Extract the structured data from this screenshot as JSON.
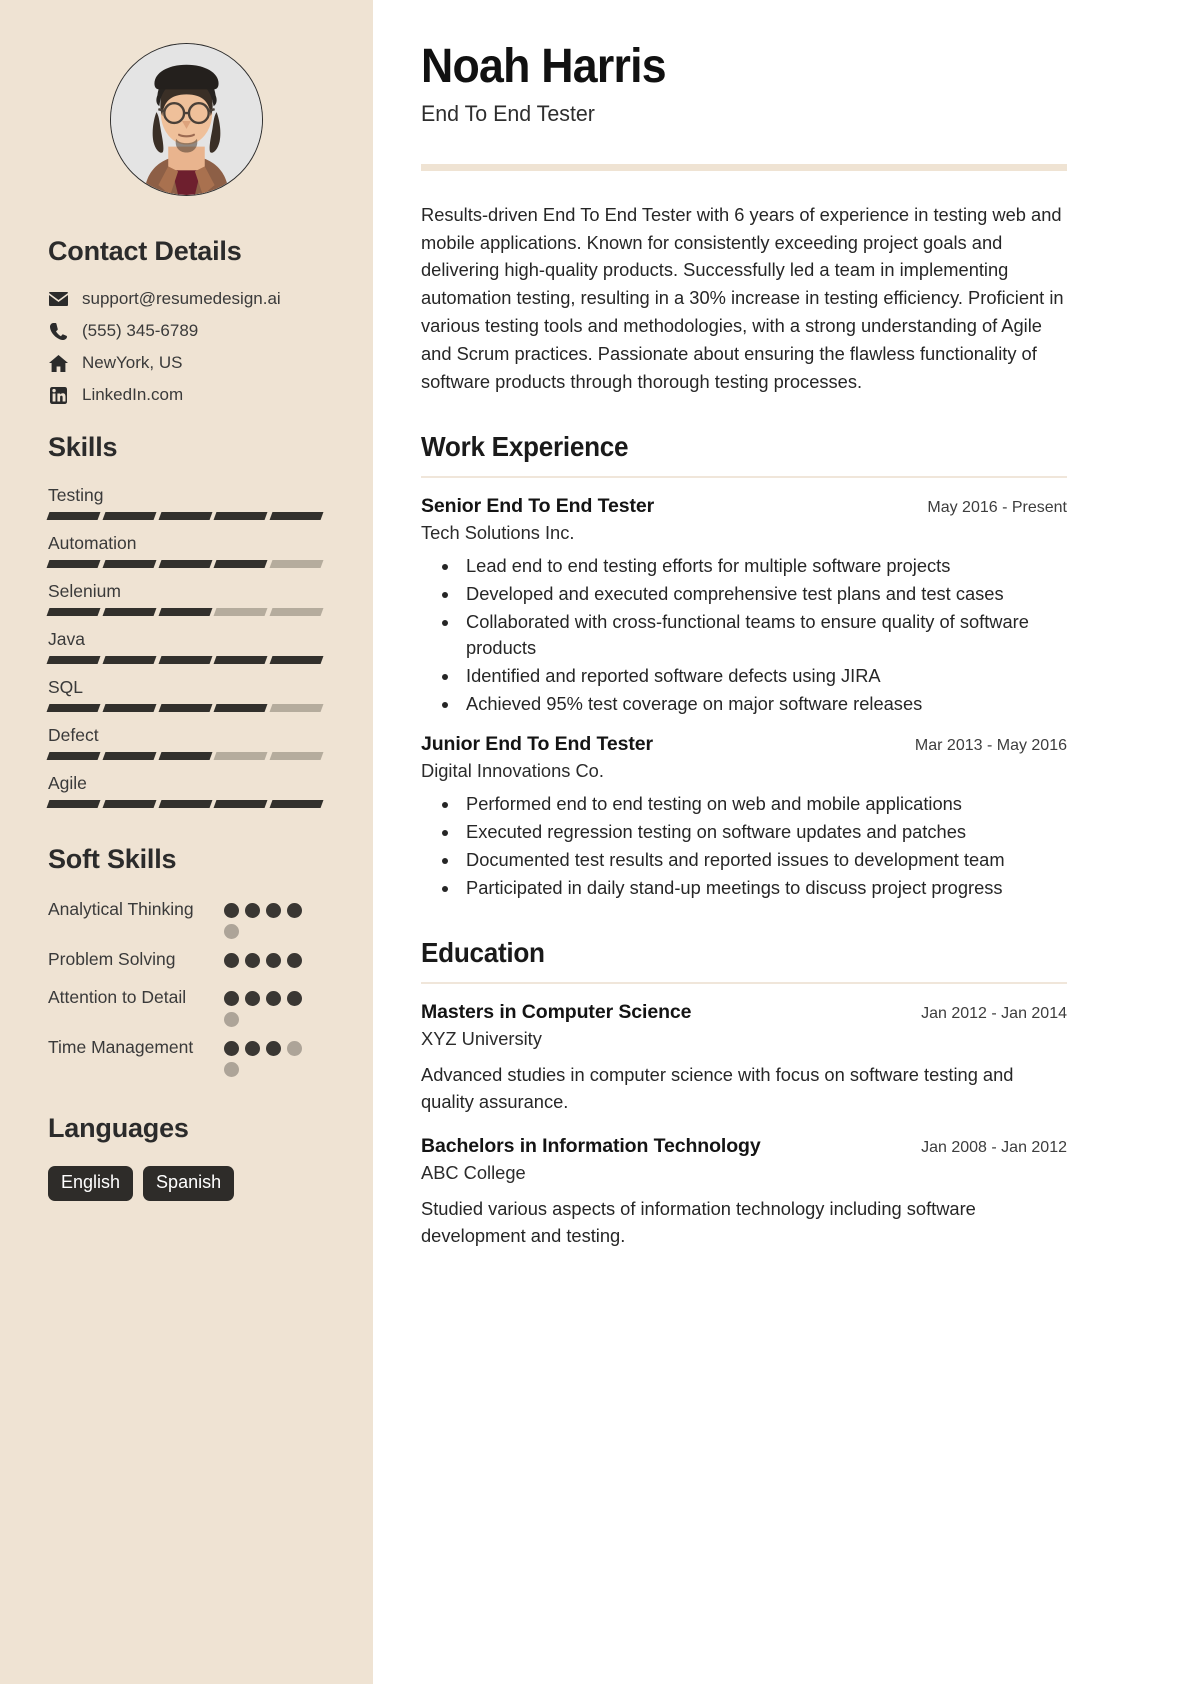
{
  "theme": {
    "sidebar_bg": "#EFE3D3",
    "accent_rule": "#EFE3D3",
    "bar_on": "#32302C",
    "bar_off": "#B5AC9D",
    "dot_on": "#3A3733",
    "dot_off": "#ADA498",
    "tag_bg": "#2E2C29",
    "text": "#262626"
  },
  "header": {
    "name": "Noah Harris",
    "role": "End To End Tester"
  },
  "summary": {
    "text": "Results-driven End To End Tester with 6 years of experience in testing web and mobile applications. Known for consistently exceeding project goals and delivering high-quality products. Successfully led a team in implementing automation testing, resulting in a 30% increase in testing efficiency. Proficient in various testing tools and methodologies, with a strong understanding of Agile and Scrum practices. Passionate about ensuring the flawless functionality of software products through thorough testing processes."
  },
  "sidebar": {
    "contact": {
      "heading": "Contact Details",
      "items": [
        {
          "icon": "envelope-icon",
          "value": "support@resumedesign.ai"
        },
        {
          "icon": "phone-icon",
          "value": "(555) 345-6789"
        },
        {
          "icon": "home-icon",
          "value": "NewYork, US"
        },
        {
          "icon": "linkedin-icon",
          "value": "LinkedIn.com"
        }
      ]
    },
    "skills": {
      "heading": "Skills",
      "max": 5,
      "items": [
        {
          "label": "Testing",
          "level": 5
        },
        {
          "label": "Automation",
          "level": 4
        },
        {
          "label": "Selenium",
          "level": 3
        },
        {
          "label": "Java",
          "level": 5
        },
        {
          "label": "SQL",
          "level": 4
        },
        {
          "label": "Defect",
          "level": 3
        },
        {
          "label": "Agile",
          "level": 5
        }
      ]
    },
    "soft_skills": {
      "heading": "Soft Skills",
      "max": 5,
      "items": [
        {
          "label": "Analytical Thinking",
          "level": 4
        },
        {
          "label": "Problem Solving",
          "level": 4,
          "total": 4
        },
        {
          "label": "Attention to Detail",
          "level": 4
        },
        {
          "label": "Time Management",
          "level": 3
        }
      ]
    },
    "languages": {
      "heading": "Languages",
      "items": [
        "English",
        "Spanish"
      ]
    }
  },
  "work": {
    "heading": "Work Experience",
    "entries": [
      {
        "title": "Senior End To End Tester",
        "date": "May 2016 - Present",
        "org": "Tech Solutions Inc.",
        "bullets": [
          "Lead end to end testing efforts for multiple software projects",
          "Developed and executed comprehensive test plans and test cases",
          "Collaborated with cross-functional teams to ensure quality of software products",
          "Identified and reported software defects using JIRA",
          "Achieved 95% test coverage on major software releases"
        ]
      },
      {
        "title": "Junior End To End Tester",
        "date": "Mar 2013 - May 2016",
        "org": "Digital Innovations Co.",
        "bullets": [
          "Performed end to end testing on web and mobile applications",
          "Executed regression testing on software updates and patches",
          "Documented test results and reported issues to development team",
          "Participated in daily stand-up meetings to discuss project progress"
        ]
      }
    ]
  },
  "education": {
    "heading": "Education",
    "entries": [
      {
        "title": "Masters in Computer Science",
        "date": "Jan 2012 - Jan 2014",
        "org": "XYZ University",
        "desc": "Advanced studies in computer science with focus on software testing and quality assurance."
      },
      {
        "title": "Bachelors in Information Technology",
        "date": "Jan 2008 - Jan 2012",
        "org": "ABC College",
        "desc": "Studied various aspects of information technology including software development and testing."
      }
    ]
  }
}
